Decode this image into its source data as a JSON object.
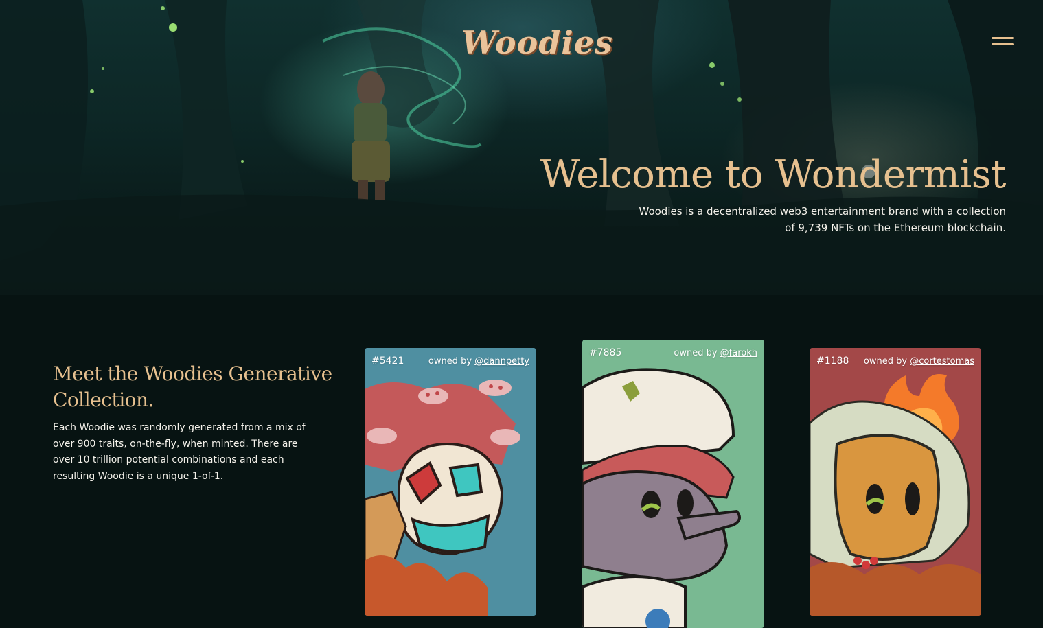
{
  "brand": {
    "logo_text": "Woodies"
  },
  "nav": {
    "menu_icon": "hamburger-menu-icon"
  },
  "hero": {
    "title": "Welcome to Wondermist",
    "description": "Woodies is a decentralized web3 entertainment brand with a collection of 9,739 NFTs on the Ethereum blockchain."
  },
  "collection": {
    "title": "Meet the Woodies Generative Collection.",
    "description": "Each Woodie was randomly generated from a mix of over 900 traits, on-the-fly, when minted. There are over 10 trillion potential combinations and each resulting Woodie is a unique 1-of-1.",
    "cards": [
      {
        "id": "#5421",
        "owned_by": "owned by",
        "owner": "@dannpetty",
        "bg_color": "#4f8fa1"
      },
      {
        "id": "#7885",
        "owned_by": "owned by",
        "owner": "@farokh",
        "bg_color": "#79b992"
      },
      {
        "id": "#1188",
        "owned_by": "owned by",
        "owner": "@cortestomas",
        "bg_color": "#a34848"
      }
    ]
  },
  "colors": {
    "accent": "#e6c08f",
    "background": "#071312",
    "text": "#f4f1ea"
  }
}
